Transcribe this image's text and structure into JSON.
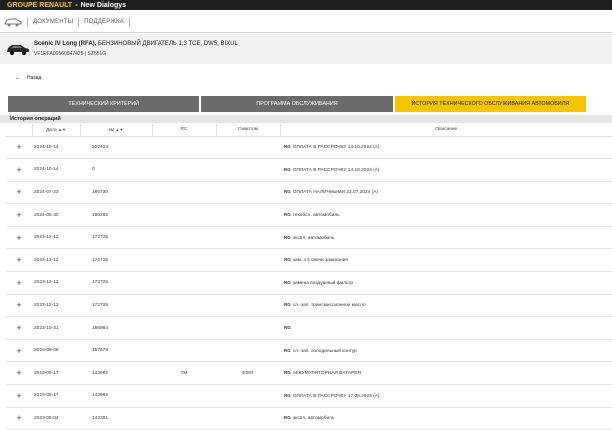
{
  "topbar": {
    "brand": "GROUPE RENAULT",
    "separator": "-",
    "app": "New Dialogys"
  },
  "nav": {
    "documents": "ДОКУМЕНТЫ",
    "support": "ПОДДЕРЖКА"
  },
  "vehicle": {
    "model": "Scenic IV Long (RFA),",
    "engine": " БЕНЗИНОВЫЙ ДВИГАТЕЛЬ 1,3 TCE, DW5, BIXUL",
    "vin": "VF1RFA00560947425 | SZ551G"
  },
  "back_label": "Назад",
  "tabs": [
    {
      "label": "ТЕХНИЧЕСКИЙ КРИТЕРИЙ"
    },
    {
      "label": "ПРОГРАММА ОБСЛУЖИВАНИЯ"
    },
    {
      "label": "ИСТОРИЯ ТЕХНИЧЕСКОГО ОБСЛУЖИВАНИЯ АВТОМОБИЛЯ"
    }
  ],
  "section_title": "История операций",
  "columns": {
    "date": "Дата",
    "km": "км",
    "rc": "RC",
    "symptom": "Симптом",
    "description": "Описание",
    "sort_icon": "sort-icon"
  },
  "rows": [
    {
      "plus": "+",
      "date": "2024-10-14",
      "km": "202424",
      "rc": "",
      "symptom": "",
      "tag": "RG",
      "description": "ОПЛАТА В РАССРОЧКУ 14.10.2024 (А)"
    },
    {
      "plus": "+",
      "date": "2024-10-14",
      "km": "0",
      "rc": "",
      "symptom": "",
      "tag": "RG",
      "description": "ОПЛАТА В РАССРОЧКУ 14.10.2024 (А)"
    },
    {
      "plus": "+",
      "date": "2024-07-23",
      "km": "186730",
      "rc": "",
      "symptom": "",
      "tag": "RG",
      "description": "ОПЛАТА НАЛИЧНЫМИ 23.07.2024 (А)"
    },
    {
      "plus": "+",
      "date": "2024-05-30",
      "km": "186292",
      "rc": "",
      "symptom": "",
      "tag": "RG",
      "description": "техобсл. автомобиль"
    },
    {
      "plus": "+",
      "date": "2023-12-12",
      "km": "172725",
      "rc": "",
      "symptom": "",
      "tag": "RG",
      "description": "экспл. автомобиль"
    },
    {
      "plus": "+",
      "date": "2023-12-12",
      "km": "172725",
      "rc": "",
      "symptom": "",
      "tag": "RG",
      "description": "зам. з 4 свечи зажигания"
    },
    {
      "plus": "+",
      "date": "2023-12-12",
      "km": "172725",
      "rc": "",
      "symptom": "",
      "tag": "RG",
      "description": "замена воздушный фильтр"
    },
    {
      "plus": "+",
      "date": "2023-12-12",
      "km": "172725",
      "rc": "",
      "symptom": "",
      "tag": "RG",
      "description": "сл.-зап. трансмиссионное масло"
    },
    {
      "plus": "+",
      "date": "2023-10-31",
      "km": "166984",
      "rc": "",
      "symptom": "",
      "tag": "RG",
      "description": ""
    },
    {
      "plus": "+",
      "date": "2023-09-06",
      "km": "157678",
      "rc": "",
      "symptom": "",
      "tag": "RG",
      "description": "сл.-зап. холодильный контур"
    },
    {
      "plus": "+",
      "date": "2023-05-17",
      "km": "143992",
      "rc": "7M",
      "symptom": "E087",
      "tag": "RG",
      "description": "АККУМУЛЯТОРНАЯ БАТАРЕЯ"
    },
    {
      "plus": "+",
      "date": "2023-05-17",
      "km": "143992",
      "rc": "",
      "symptom": "",
      "tag": "RG",
      "description": "ОПЛАТА В РАССРОЧКУ 17.05.2023 (А)"
    },
    {
      "plus": "+",
      "date": "2023-05-04",
      "km": "142281",
      "rc": "",
      "symptom": "",
      "tag": "RG",
      "description": "экспл. автомобиль"
    }
  ]
}
